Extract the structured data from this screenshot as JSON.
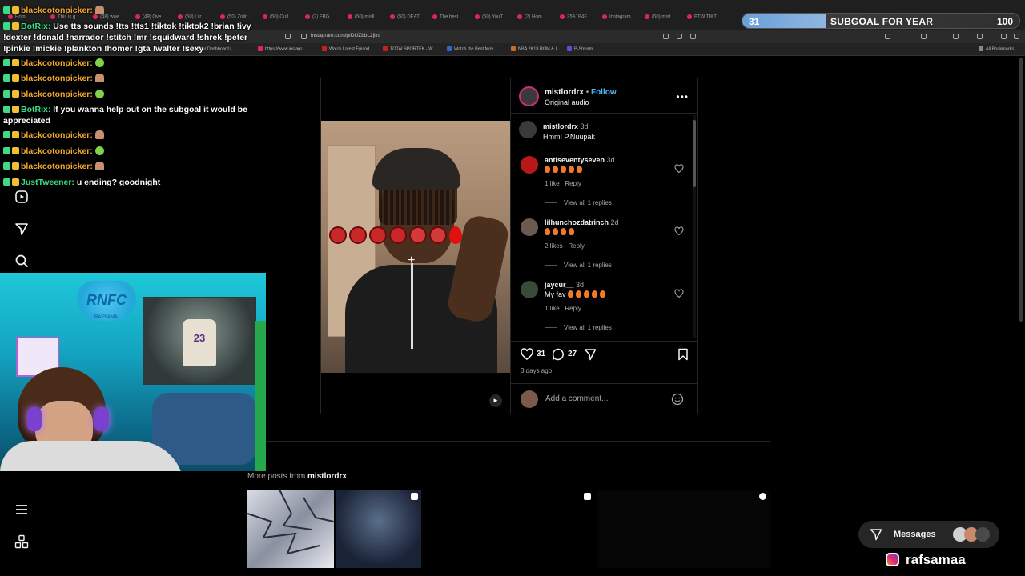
{
  "browser": {
    "tabs": [
      "Hom",
      "This is g",
      "(48) wwe",
      "(49) Ove",
      "(50) Lilr",
      "(50) Zolin",
      "(50) Outl",
      "(2) FBG",
      "(50) misll",
      "(50) DEAT",
      "The best",
      "(50) YouT",
      "(2) Hom",
      "25A1B4F",
      "Instagram",
      "(50) mist",
      "BTW TIKT"
    ],
    "url": "instagram.com/p/DUZbbL2jlin/",
    "bookmarks": [
      "Creator Dashboard |...",
      "https://www.instagr...",
      "Watch Latest Episod...",
      "TOTALSPORTEK - W...",
      "Watch the Best Mov...",
      "NBA 2K18 ROM & I...",
      "P-Stream"
    ],
    "all_bookmarks": "All Bookmarks"
  },
  "subgoal": {
    "current": "31",
    "label": "SUBGOAL FOR YEAR",
    "target": "100"
  },
  "chat": {
    "messages": [
      {
        "user": "blackcotonpicker:",
        "text": "",
        "color": "#f0a830",
        "emote": "person"
      },
      {
        "user": "BotRix:",
        "text": "Use tts sounds !tts !tts1 !tiktok !tiktok2 !brian !ivy !dexter !donald !narrador !stitch !mr !squidward !shrek !peter !pinkie !mickie !plankton !homer !gta !walter !sexy",
        "color": "#3ddc84",
        "emote": ""
      },
      {
        "user": "blackcotonpicker:",
        "text": "",
        "color": "#f0a830",
        "emote": "green"
      },
      {
        "user": "blackcotonpicker:",
        "text": "",
        "color": "#f0a830",
        "emote": "person"
      },
      {
        "user": "blackcotonpicker:",
        "text": "",
        "color": "#f0a830",
        "emote": "green"
      },
      {
        "user": "BotRix:",
        "text": "If you wanna help out on the subgoal it would be appreciated",
        "color": "#3ddc84",
        "emote": ""
      },
      {
        "user": "blackcotonpicker:",
        "text": "",
        "color": "#f0a830",
        "emote": "person"
      },
      {
        "user": "blackcotonpicker:",
        "text": "",
        "color": "#f0a830",
        "emote": "green"
      },
      {
        "user": "blackcotonpicker:",
        "text": "",
        "color": "#f0a830",
        "emote": "person"
      },
      {
        "user": "JustTweener:",
        "text": "u ending? goodnight",
        "color": "#3ddc84",
        "emote": ""
      }
    ]
  },
  "webcam": {
    "banner": "RNFC",
    "banner_sub": "RAFSAMA",
    "jersey": "23"
  },
  "post": {
    "author": "mistlordrx",
    "follow": "Follow",
    "audio": "Original audio",
    "caption_user": "mistlordrx",
    "caption_age": "3d",
    "caption": "Hmm! P.Nuupak",
    "comments": [
      {
        "user": "antiseventyseven",
        "age": "3d",
        "text": "",
        "fires": 5,
        "likes": "1 like",
        "reply": "Reply",
        "replies": "View all 1 replies"
      },
      {
        "user": "lilhunchozdatrinch",
        "age": "2d",
        "text": "",
        "fires": 4,
        "likes": "2 likes",
        "reply": "Reply",
        "replies": "View all 1 replies"
      },
      {
        "user": "jaycur__",
        "age": "3d",
        "text": "My fav",
        "fires": 5,
        "likes": "1 like",
        "reply": "Reply",
        "replies": "View all 1 replies"
      }
    ],
    "like_count": "31",
    "comment_count": "27",
    "time_ago": "3 days ago",
    "add_comment_placeholder": "Add a comment..."
  },
  "more_posts": {
    "prefix": "More posts from",
    "user": "mistlordrx"
  },
  "messages_label": "Messages",
  "streamer_handle": "rafsamaa"
}
